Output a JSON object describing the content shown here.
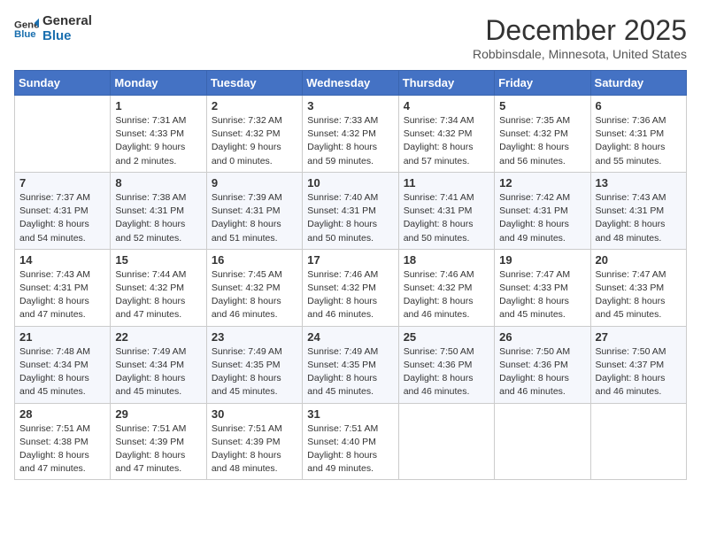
{
  "header": {
    "logo": {
      "general": "General",
      "blue": "Blue"
    },
    "title": "December 2025",
    "location": "Robbinsdale, Minnesota, United States"
  },
  "calendar": {
    "days_of_week": [
      "Sunday",
      "Monday",
      "Tuesday",
      "Wednesday",
      "Thursday",
      "Friday",
      "Saturday"
    ],
    "weeks": [
      [
        {
          "day": "",
          "sunrise": "",
          "sunset": "",
          "daylight": ""
        },
        {
          "day": "1",
          "sunrise": "Sunrise: 7:31 AM",
          "sunset": "Sunset: 4:33 PM",
          "daylight": "Daylight: 9 hours and 2 minutes."
        },
        {
          "day": "2",
          "sunrise": "Sunrise: 7:32 AM",
          "sunset": "Sunset: 4:32 PM",
          "daylight": "Daylight: 9 hours and 0 minutes."
        },
        {
          "day": "3",
          "sunrise": "Sunrise: 7:33 AM",
          "sunset": "Sunset: 4:32 PM",
          "daylight": "Daylight: 8 hours and 59 minutes."
        },
        {
          "day": "4",
          "sunrise": "Sunrise: 7:34 AM",
          "sunset": "Sunset: 4:32 PM",
          "daylight": "Daylight: 8 hours and 57 minutes."
        },
        {
          "day": "5",
          "sunrise": "Sunrise: 7:35 AM",
          "sunset": "Sunset: 4:32 PM",
          "daylight": "Daylight: 8 hours and 56 minutes."
        },
        {
          "day": "6",
          "sunrise": "Sunrise: 7:36 AM",
          "sunset": "Sunset: 4:31 PM",
          "daylight": "Daylight: 8 hours and 55 minutes."
        }
      ],
      [
        {
          "day": "7",
          "sunrise": "Sunrise: 7:37 AM",
          "sunset": "Sunset: 4:31 PM",
          "daylight": "Daylight: 8 hours and 54 minutes."
        },
        {
          "day": "8",
          "sunrise": "Sunrise: 7:38 AM",
          "sunset": "Sunset: 4:31 PM",
          "daylight": "Daylight: 8 hours and 52 minutes."
        },
        {
          "day": "9",
          "sunrise": "Sunrise: 7:39 AM",
          "sunset": "Sunset: 4:31 PM",
          "daylight": "Daylight: 8 hours and 51 minutes."
        },
        {
          "day": "10",
          "sunrise": "Sunrise: 7:40 AM",
          "sunset": "Sunset: 4:31 PM",
          "daylight": "Daylight: 8 hours and 50 minutes."
        },
        {
          "day": "11",
          "sunrise": "Sunrise: 7:41 AM",
          "sunset": "Sunset: 4:31 PM",
          "daylight": "Daylight: 8 hours and 50 minutes."
        },
        {
          "day": "12",
          "sunrise": "Sunrise: 7:42 AM",
          "sunset": "Sunset: 4:31 PM",
          "daylight": "Daylight: 8 hours and 49 minutes."
        },
        {
          "day": "13",
          "sunrise": "Sunrise: 7:43 AM",
          "sunset": "Sunset: 4:31 PM",
          "daylight": "Daylight: 8 hours and 48 minutes."
        }
      ],
      [
        {
          "day": "14",
          "sunrise": "Sunrise: 7:43 AM",
          "sunset": "Sunset: 4:31 PM",
          "daylight": "Daylight: 8 hours and 47 minutes."
        },
        {
          "day": "15",
          "sunrise": "Sunrise: 7:44 AM",
          "sunset": "Sunset: 4:32 PM",
          "daylight": "Daylight: 8 hours and 47 minutes."
        },
        {
          "day": "16",
          "sunrise": "Sunrise: 7:45 AM",
          "sunset": "Sunset: 4:32 PM",
          "daylight": "Daylight: 8 hours and 46 minutes."
        },
        {
          "day": "17",
          "sunrise": "Sunrise: 7:46 AM",
          "sunset": "Sunset: 4:32 PM",
          "daylight": "Daylight: 8 hours and 46 minutes."
        },
        {
          "day": "18",
          "sunrise": "Sunrise: 7:46 AM",
          "sunset": "Sunset: 4:32 PM",
          "daylight": "Daylight: 8 hours and 46 minutes."
        },
        {
          "day": "19",
          "sunrise": "Sunrise: 7:47 AM",
          "sunset": "Sunset: 4:33 PM",
          "daylight": "Daylight: 8 hours and 45 minutes."
        },
        {
          "day": "20",
          "sunrise": "Sunrise: 7:47 AM",
          "sunset": "Sunset: 4:33 PM",
          "daylight": "Daylight: 8 hours and 45 minutes."
        }
      ],
      [
        {
          "day": "21",
          "sunrise": "Sunrise: 7:48 AM",
          "sunset": "Sunset: 4:34 PM",
          "daylight": "Daylight: 8 hours and 45 minutes."
        },
        {
          "day": "22",
          "sunrise": "Sunrise: 7:49 AM",
          "sunset": "Sunset: 4:34 PM",
          "daylight": "Daylight: 8 hours and 45 minutes."
        },
        {
          "day": "23",
          "sunrise": "Sunrise: 7:49 AM",
          "sunset": "Sunset: 4:35 PM",
          "daylight": "Daylight: 8 hours and 45 minutes."
        },
        {
          "day": "24",
          "sunrise": "Sunrise: 7:49 AM",
          "sunset": "Sunset: 4:35 PM",
          "daylight": "Daylight: 8 hours and 45 minutes."
        },
        {
          "day": "25",
          "sunrise": "Sunrise: 7:50 AM",
          "sunset": "Sunset: 4:36 PM",
          "daylight": "Daylight: 8 hours and 46 minutes."
        },
        {
          "day": "26",
          "sunrise": "Sunrise: 7:50 AM",
          "sunset": "Sunset: 4:36 PM",
          "daylight": "Daylight: 8 hours and 46 minutes."
        },
        {
          "day": "27",
          "sunrise": "Sunrise: 7:50 AM",
          "sunset": "Sunset: 4:37 PM",
          "daylight": "Daylight: 8 hours and 46 minutes."
        }
      ],
      [
        {
          "day": "28",
          "sunrise": "Sunrise: 7:51 AM",
          "sunset": "Sunset: 4:38 PM",
          "daylight": "Daylight: 8 hours and 47 minutes."
        },
        {
          "day": "29",
          "sunrise": "Sunrise: 7:51 AM",
          "sunset": "Sunset: 4:39 PM",
          "daylight": "Daylight: 8 hours and 47 minutes."
        },
        {
          "day": "30",
          "sunrise": "Sunrise: 7:51 AM",
          "sunset": "Sunset: 4:39 PM",
          "daylight": "Daylight: 8 hours and 48 minutes."
        },
        {
          "day": "31",
          "sunrise": "Sunrise: 7:51 AM",
          "sunset": "Sunset: 4:40 PM",
          "daylight": "Daylight: 8 hours and 49 minutes."
        },
        {
          "day": "",
          "sunrise": "",
          "sunset": "",
          "daylight": ""
        },
        {
          "day": "",
          "sunrise": "",
          "sunset": "",
          "daylight": ""
        },
        {
          "day": "",
          "sunrise": "",
          "sunset": "",
          "daylight": ""
        }
      ]
    ]
  }
}
